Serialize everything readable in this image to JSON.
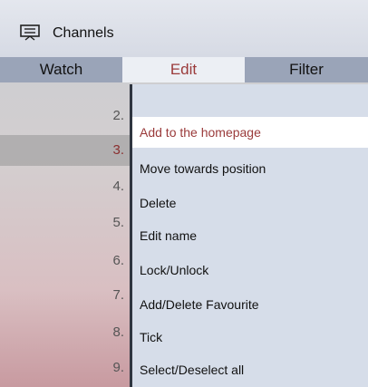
{
  "header": {
    "title": "Channels",
    "icon": "tv-list-icon"
  },
  "tabs": [
    {
      "label": "Watch",
      "active": false
    },
    {
      "label": "Edit",
      "active": true
    },
    {
      "label": "Filter",
      "active": false
    }
  ],
  "channels": [
    "2.",
    "3.",
    "4.",
    "5.",
    "6.",
    "7.",
    "8.",
    "9."
  ],
  "menu": {
    "items": [
      "Add to the homepage",
      "Move towards position",
      "Delete",
      "Edit name",
      "Lock/Unlock",
      "Add/Delete Favourite",
      "Tick",
      "Select/Deselect all"
    ],
    "selected_index": 0
  },
  "colors": {
    "accent": "#9a3a3a",
    "tab_bar": "#9aa4b8",
    "menu_bg": "#d6dde9"
  }
}
